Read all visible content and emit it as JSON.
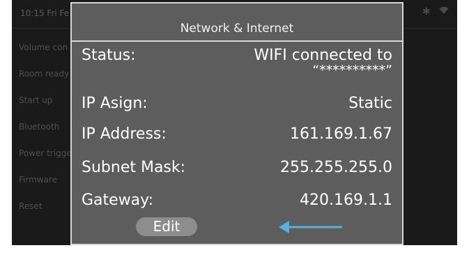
{
  "status_bar": {
    "time": "10:15 Fri Fe",
    "icons": [
      "bluetooth-icon",
      "wifi-icon"
    ]
  },
  "background_menu": {
    "items": [
      {
        "label": "Volume con"
      },
      {
        "label": "Room ready"
      },
      {
        "label": "Start up"
      },
      {
        "label": "Bluetooth"
      },
      {
        "label": "Power trigge"
      },
      {
        "label": "Firmware"
      },
      {
        "label": "Reset"
      }
    ]
  },
  "dialog": {
    "title": "Network & Internet",
    "rows": [
      {
        "label": "Status:",
        "value": "WIFI connected to",
        "value_sub": "“**********”"
      },
      {
        "label": "IP Asign:",
        "value": "Static"
      },
      {
        "label": "IP Address:",
        "value": "161.169.1.67"
      },
      {
        "label": "Subnet Mask:",
        "value": "255.255.255.0"
      },
      {
        "label": "Gateway:",
        "value": "420.169.1.1"
      }
    ],
    "edit_label": "Edit"
  },
  "colors": {
    "dialog_bg": "#5d5d5d",
    "dialog_border": "#d8d8d8",
    "edit_button": "#8d8d8d",
    "arrow": "#5aaee0",
    "screen_bg": "#1a1a1a"
  }
}
